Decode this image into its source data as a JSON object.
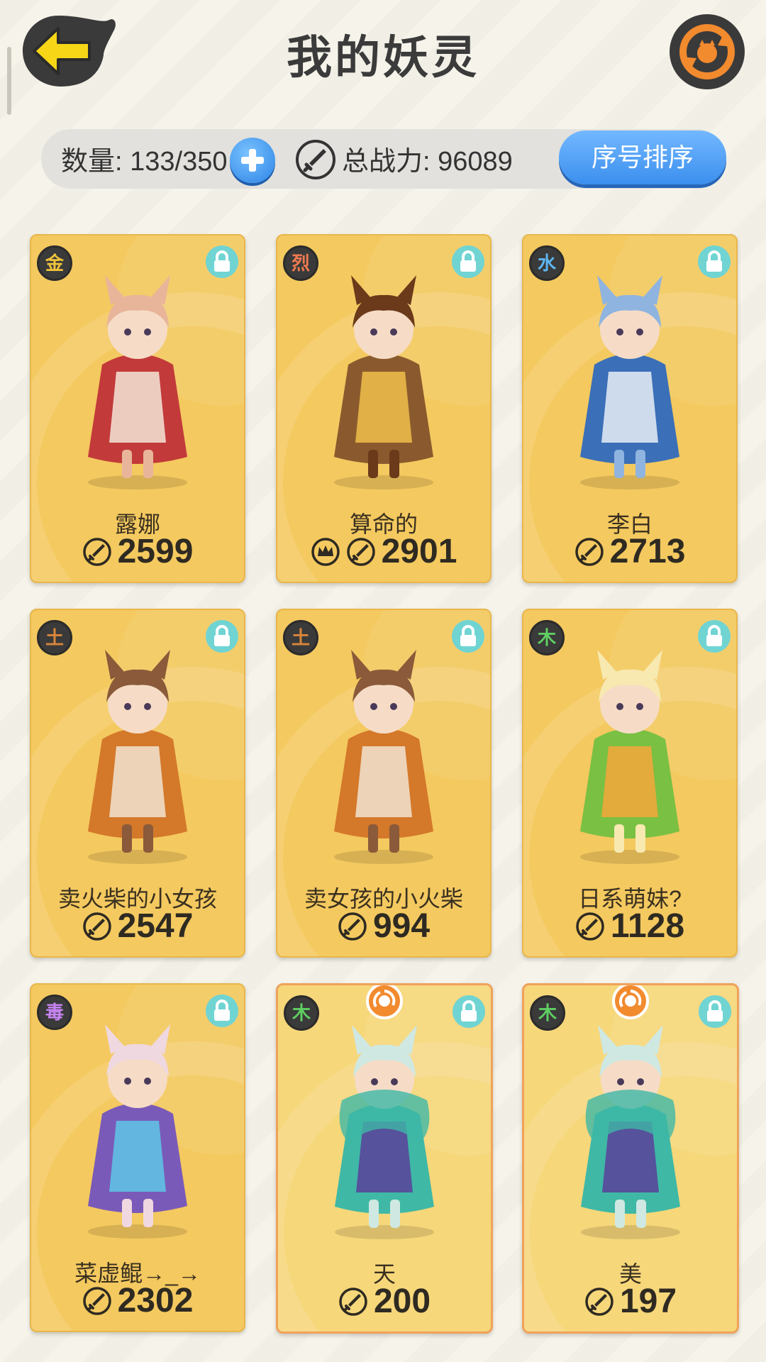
{
  "header": {
    "title": "我的妖灵"
  },
  "stats": {
    "count_label": "数量: 133/350",
    "power_label": "总战力: 96089",
    "sort_label": "序号排序"
  },
  "colors": {
    "card_gold": "#f4c95f",
    "accent_blue": "#3b8fee",
    "lock_teal": "#70d4d2",
    "special_emblem": "#f28a2e"
  },
  "cards": [
    {
      "name": "露娜",
      "power": "2599",
      "element": "金",
      "element_color": "#f0c53a",
      "crown": false,
      "special": false
    },
    {
      "name": "算命的",
      "power": "2901",
      "element": "烈",
      "element_color": "#f07a4f",
      "crown": true,
      "special": false
    },
    {
      "name": "李白",
      "power": "2713",
      "element": "水",
      "element_color": "#5fb6f2",
      "crown": false,
      "special": false
    },
    {
      "name": "卖火柴的小女孩",
      "power": "2547",
      "element": "土",
      "element_color": "#d9863a",
      "crown": false,
      "special": false
    },
    {
      "name": "卖女孩的小火柴",
      "power": "994",
      "element": "土",
      "element_color": "#d9863a",
      "crown": false,
      "special": false
    },
    {
      "name": "日系萌妹?",
      "power": "1128",
      "element": "木",
      "element_color": "#5fcf62",
      "crown": false,
      "special": false
    },
    {
      "name": "菜虚鲲→_→",
      "power": "2302",
      "element": "毒",
      "element_color": "#c784f2",
      "crown": false,
      "special": false
    },
    {
      "name": "天",
      "power": "200",
      "element": "木",
      "element_color": "#5fcf62",
      "crown": false,
      "special": true
    },
    {
      "name": "美",
      "power": "197",
      "element": "木",
      "element_color": "#5fcf62",
      "crown": false,
      "special": true
    }
  ]
}
